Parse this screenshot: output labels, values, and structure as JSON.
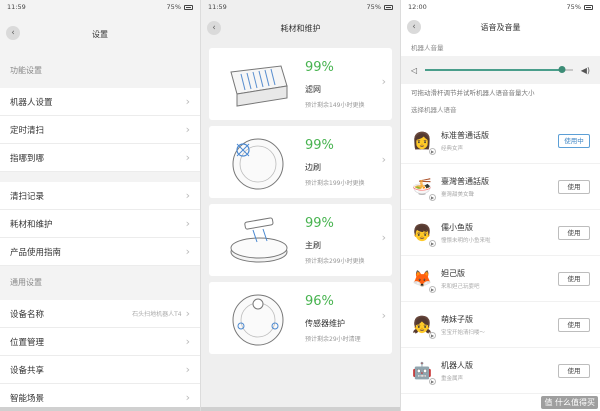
{
  "panel1": {
    "status": {
      "time": "11:59",
      "battery": "75%"
    },
    "title": "设置",
    "sections": [
      {
        "label": "功能设置",
        "items": [
          {
            "label": "机器人设置"
          },
          {
            "label": "定时清扫"
          },
          {
            "label": "指哪到哪"
          }
        ]
      },
      {
        "label": "",
        "items": [
          {
            "label": "清扫记录"
          },
          {
            "label": "耗材和维护"
          },
          {
            "label": "产品使用指南"
          }
        ]
      },
      {
        "label": "通用设置",
        "items": [
          {
            "label": "设备名称",
            "value": "石头扫地机器人T4"
          },
          {
            "label": "位置管理"
          },
          {
            "label": "设备共享"
          },
          {
            "label": "智能场景"
          }
        ]
      }
    ]
  },
  "panel2": {
    "status": {
      "time": "11:59",
      "battery": "75%"
    },
    "title": "耗材和维护",
    "cards": [
      {
        "percent": "99%",
        "name": "滤网",
        "remaining": "预计剩余149小时更换",
        "icon": "filter-icon"
      },
      {
        "percent": "99%",
        "name": "边刷",
        "remaining": "预计剩余199小时更换",
        "icon": "side-brush-icon"
      },
      {
        "percent": "99%",
        "name": "主刷",
        "remaining": "预计剩余299小时更换",
        "icon": "main-brush-icon"
      },
      {
        "percent": "96%",
        "name": "传感器维护",
        "remaining": "预计剩余29小时清理",
        "icon": "sensor-icon"
      }
    ],
    "accent": "#47b34f"
  },
  "panel3": {
    "status": {
      "time": "12:00",
      "battery": "75%"
    },
    "title": "语音及音量",
    "volume_label": "机器人音量",
    "volume_level": 0.93,
    "hint": "可拖动滑杆调节并试听机器人语音音量大小",
    "voice_label": "选择机器人语音",
    "voices": [
      {
        "name": "标准普通话版",
        "desc": "经典女声",
        "button": "使用中",
        "active": true,
        "icon": "woman-avatar-icon"
      },
      {
        "name": "臺灣普通話版",
        "desc": "臺灣甜美女聲",
        "button": "使用",
        "active": false,
        "icon": "bowl-avatar-icon"
      },
      {
        "name": "儒小鱼版",
        "desc": "憧憬未明的小鱼来啦",
        "button": "使用",
        "active": false,
        "icon": "boy-avatar-icon"
      },
      {
        "name": "妲己版",
        "desc": "来和妲己玩耍吧",
        "button": "使用",
        "active": false,
        "icon": "fox-avatar-icon"
      },
      {
        "name": "萌妹子版",
        "desc": "宝宝开始清扫喽～",
        "button": "使用",
        "active": false,
        "icon": "girl-avatar-icon"
      },
      {
        "name": "机器人版",
        "desc": "重金属声",
        "button": "使用",
        "active": false,
        "icon": "robot-avatar-icon"
      }
    ],
    "slider_color": "#4a9e8b"
  },
  "watermark": "值 什么值得买"
}
